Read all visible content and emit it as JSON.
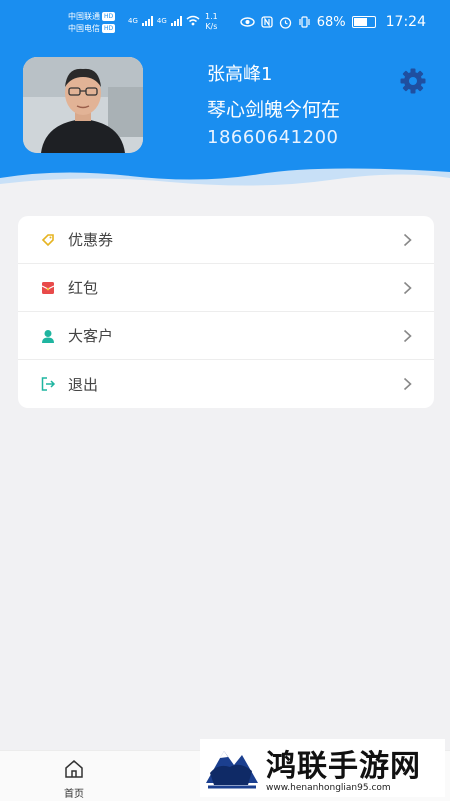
{
  "status_bar": {
    "carrier_1": "中国联通",
    "carrier_2": "中国电信",
    "hd_badge": "HD",
    "network_1": "4G",
    "network_2": "4G",
    "speed_value": "1.1",
    "speed_unit": "K/s",
    "battery": "68%",
    "battery_level": 0.68,
    "time": "17:24"
  },
  "profile": {
    "name": "张高峰1",
    "motto": "琴心剑魄今何在",
    "phone": "18660641200"
  },
  "menu": {
    "items": [
      {
        "label": "优惠券",
        "icon": "coupon-icon",
        "color": "#e6b422"
      },
      {
        "label": "红包",
        "icon": "red-envelope-icon",
        "color": "#e84a4a"
      },
      {
        "label": "大客户",
        "icon": "user-icon",
        "color": "#1fb5a0"
      },
      {
        "label": "退出",
        "icon": "logout-icon",
        "color": "#1fb5a0"
      }
    ]
  },
  "bottom_nav": {
    "home_label": "首页"
  },
  "watermark": {
    "title": "鸿联手游网",
    "url": "www.henanhonglian95.com"
  },
  "colors": {
    "header": "#1a8ef0",
    "background": "#f1f1f3",
    "card": "#ffffff"
  }
}
